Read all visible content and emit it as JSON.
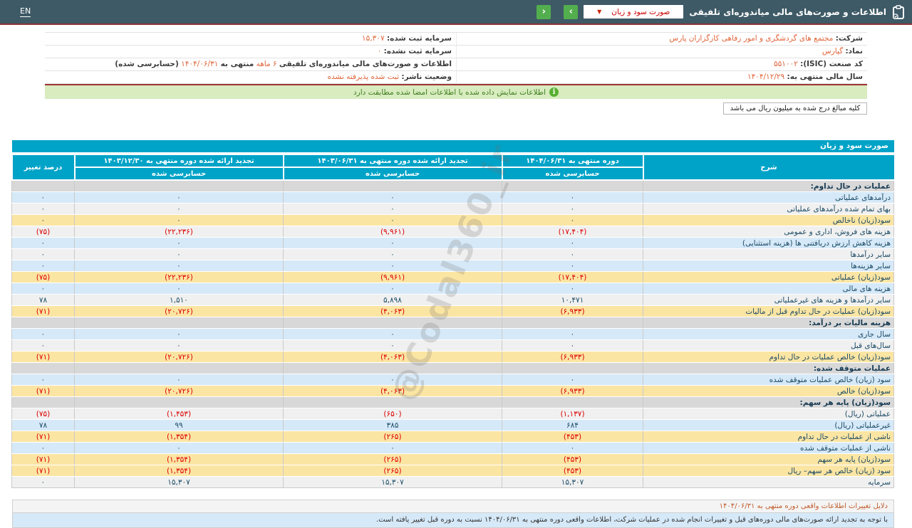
{
  "header": {
    "en_label": "EN",
    "title": "اطلاعات و صورت‌های مالی میاندوره‌ای تلفیقی",
    "statement_selector": "صورت سود و زیان",
    "icons": {
      "caret": "▼",
      "prev": "‹",
      "next": "›",
      "notice_info": "i"
    },
    "colors": {
      "bar_bg": "#3e5a66",
      "button_green": "#53ae4e",
      "selector_text": "#cc0000"
    }
  },
  "info": {
    "right": [
      {
        "label": "شرکت:",
        "value": "مجتمع های گردشگری و امور رفاهی کارگزاران پارس"
      },
      {
        "label": "نماد:",
        "value": "گپارس"
      },
      {
        "label": "کد صنعت (ISIC):",
        "value": "۵۵۱۰۰۲"
      },
      {
        "label": "سال مالی منتهی به:",
        "value": "۱۴۰۴/۱۲/۲۹"
      }
    ],
    "left": [
      {
        "label": "سرمایه ثبت شده:",
        "value": "۱۵,۳۰۷"
      },
      {
        "label": "سرمایه ثبت نشده:",
        "value": "۰"
      },
      {
        "label": "وضعیت ناشر:",
        "value": "ثبت شده پذیرفته نشده"
      }
    ],
    "period_row": {
      "p1": "اطلاعات و صورت‌های مالی میاندوره‌ای تلفیقی",
      "p2": "۶ ماهه",
      "p3": "منتهی به",
      "p4": "۱۴۰۴/۰۶/۳۱",
      "p5": "(حسابرسی شده)"
    }
  },
  "notice": {
    "text": "اطلاعات نمایش داده شده با اطلاعات امضا شده مطابقت دارد"
  },
  "unit_note": "کلیه مبالغ درج شده به میلیون ریال می باشد",
  "watermark": "@Codal360_ir",
  "table": {
    "title": "صورت سود و زیان",
    "columns": {
      "desc": "شرح",
      "c1_line1": "دوره منتهی به ۱۴۰۴/۰۶/۳۱",
      "c2_line1": "تجدید ارائه شده دوره منتهی به ۱۴۰۳/۰۶/۳۱",
      "c3_line1": "تجدید ارائه شده دوره منتهی به ۱۴۰۳/۱۲/۳۰",
      "audited": "حسابرسی شده",
      "pct": "درصد تغییر"
    },
    "rows": [
      {
        "label": "عملیات در حال تداوم:",
        "type": "section"
      },
      {
        "label": "درآمدهای عملیاتی",
        "type": "blue",
        "values": [
          "۰",
          "۰",
          "۰",
          "۰"
        ]
      },
      {
        "label": "بهای تمام شده درآمدهای عملیاتی",
        "type": "plain",
        "values": [
          "۰",
          "۰",
          "۰",
          "۰"
        ]
      },
      {
        "label": "سود(زیان) ناخالص",
        "type": "yellow",
        "values": [
          "۰",
          "۰",
          "۰",
          "۰"
        ]
      },
      {
        "label": "هزینه های فروش، اداری و عمومی",
        "type": "plain",
        "values": [
          "(۱۷,۴۰۴)",
          "(۹,۹۶۱)",
          "(۲۲,۲۳۶)",
          "(۷۵)"
        ]
      },
      {
        "label": "هزینه کاهش ارزش دریافتنی ها (هزینه استثنایی)",
        "type": "blue",
        "values": [
          "۰",
          "۰",
          "۰",
          "۰"
        ]
      },
      {
        "label": "سایر درآمدها",
        "type": "plain",
        "values": [
          "۰",
          "۰",
          "۰",
          "۰"
        ]
      },
      {
        "label": "سایر هزینه‌ها",
        "type": "blue",
        "values": [
          "۰",
          "۰",
          "۰",
          "۰"
        ]
      },
      {
        "label": "سود(زیان) عملیاتی",
        "type": "yellow",
        "values": [
          "(۱۷,۴۰۴)",
          "(۹,۹۶۱)",
          "(۲۲,۲۳۶)",
          "(۷۵)"
        ]
      },
      {
        "label": "هزینه های مالی",
        "type": "blue",
        "values": [
          "۰",
          "۰",
          "۰",
          "۰"
        ]
      },
      {
        "label": "سایر درآمدها و هزینه های غیرعملیاتی",
        "type": "plain",
        "values": [
          "۱۰,۴۷۱",
          "۵,۸۹۸",
          "۱,۵۱۰",
          "۷۸"
        ]
      },
      {
        "label": "سود(زیان) عملیات در حال تداوم قبل از مالیات",
        "type": "yellow",
        "values": [
          "(۶,۹۳۳)",
          "(۴,۰۶۳)",
          "(۲۰,۷۲۶)",
          "(۷۱)"
        ]
      },
      {
        "label": "هزینه مالیات بر درآمد:",
        "type": "section"
      },
      {
        "label": "سال جاری",
        "type": "blue",
        "values": [
          "۰",
          "۰",
          "۰",
          "۰"
        ]
      },
      {
        "label": "سال‌های قبل",
        "type": "plain",
        "values": [
          "۰",
          "۰",
          "۰",
          "۰"
        ]
      },
      {
        "label": "سود(زیان) خالص عملیات در حال تداوم",
        "type": "yellow",
        "values": [
          "(۶,۹۳۳)",
          "(۴,۰۶۳)",
          "(۲۰,۷۲۶)",
          "(۷۱)"
        ]
      },
      {
        "label": "عملیات متوقف شده:",
        "type": "section"
      },
      {
        "label": "سود (زیان) خالص عملیات متوقف شده",
        "type": "blue",
        "values": [
          "۰",
          "۰",
          "۰",
          "۰"
        ]
      },
      {
        "label": "سود(زیان) خالص",
        "type": "yellow",
        "values": [
          "(۶,۹۳۳)",
          "(۴,۰۶۳)",
          "(۲۰,۷۲۶)",
          "(۷۱)"
        ]
      },
      {
        "label": "سود(زیان) پایه هر سهم:",
        "type": "section"
      },
      {
        "label": "عملیاتی (ریال)",
        "type": "plain",
        "values": [
          "(۱,۱۳۷)",
          "(۶۵۰)",
          "(۱,۴۵۳)",
          "(۷۵)"
        ]
      },
      {
        "label": "غیرعملیاتی (ریال)",
        "type": "blue",
        "values": [
          "۶۸۴",
          "۳۸۵",
          "۹۹",
          "۷۸"
        ]
      },
      {
        "label": "ناشی از عملیات در حال تداوم",
        "type": "yellow",
        "values": [
          "(۴۵۳)",
          "(۲۶۵)",
          "(۱,۳۵۴)",
          "(۷۱)"
        ]
      },
      {
        "label": "ناشی از عملیات متوقف شده",
        "type": "blue",
        "values": [
          "۰",
          "۰",
          "۰",
          "۰"
        ]
      },
      {
        "label": "سود(زیان) پایه هر سهم",
        "type": "yellow",
        "values": [
          "(۴۵۳)",
          "(۲۶۵)",
          "(۱,۳۵۴)",
          "(۷۱)"
        ]
      },
      {
        "label": "سود (زیان) خالص هر سهم– ریال",
        "type": "yellow",
        "values": [
          "(۴۵۳)",
          "(۲۶۵)",
          "(۱,۳۵۴)",
          "(۷۱)"
        ]
      },
      {
        "label": "سرمایه",
        "type": "plain",
        "values": [
          "۱۵,۳۰۷",
          "۱۵,۳۰۷",
          "۱۵,۳۰۷",
          "۰"
        ]
      }
    ]
  },
  "footnote": {
    "title": "دلایل تغییرات اطلاعات واقعی دوره منتهی به ۱۴۰۴/۰۶/۳۱",
    "body": "با توجه به تجدید ارائه صورت‌های مالی دوره‌های قبل و تغییرات انجام شده در عملیات شرکت، اطلاعات واقعی دوره منتهی به ۱۴۰۴/۰۶/۳۱ نسبت به دوره قبل تغییر یافته است."
  }
}
